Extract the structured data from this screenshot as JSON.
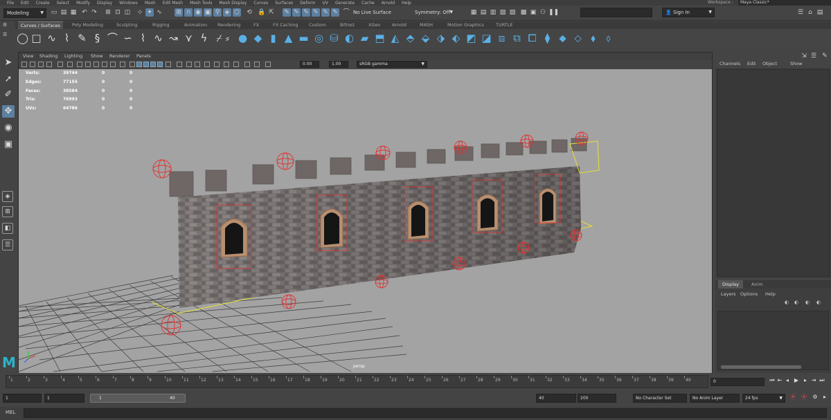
{
  "menubar": {
    "items": [
      "File",
      "Edit",
      "Create",
      "Select",
      "Modify",
      "Display",
      "Windows",
      "Mesh",
      "Edit Mesh",
      "Mesh Tools",
      "Mesh Display",
      "Curves",
      "Surfaces",
      "Deform",
      "UV",
      "Generate",
      "Cache",
      "Arnold",
      "Help"
    ],
    "workspace_label": "Workspace :",
    "workspace_value": "Maya Classic*"
  },
  "statusline": {
    "menuset": "Modeling",
    "live_surface": "No Live Surface",
    "symmetry": "Symmetry: Off",
    "sign_in": "Sign In"
  },
  "shelf": {
    "tabs": [
      "Curves / Surfaces",
      "Poly Modeling",
      "Sculpting",
      "Rigging",
      "Animation",
      "Rendering",
      "FX",
      "FX Caching",
      "Custom",
      "Bifrost",
      "XGen",
      "Arnold",
      "MASH",
      "Motion Graphics",
      "TURTLE"
    ],
    "active_tab": "Curves / Surfaces"
  },
  "panel": {
    "menus": [
      "View",
      "Shading",
      "Lighting",
      "Show",
      "Renderer",
      "Panels"
    ],
    "exposure": "0.00",
    "gamma": "1.00",
    "color_space": "sRGB gamma",
    "camera": "persp"
  },
  "hud": {
    "rows": [
      {
        "label": "Verts:",
        "total": "39744",
        "selected": "0",
        "components": "0"
      },
      {
        "label": "Edges:",
        "total": "77155",
        "selected": "0",
        "components": "0"
      },
      {
        "label": "Faces:",
        "total": "38584",
        "selected": "0",
        "components": "0"
      },
      {
        "label": "Tris:",
        "total": "76993",
        "selected": "0",
        "components": "0"
      },
      {
        "label": "UVs:",
        "total": "64786",
        "selected": "0",
        "components": "0"
      }
    ]
  },
  "channelbox": {
    "menus": [
      "Channels",
      "Edit",
      "Object",
      "Show"
    ]
  },
  "layerbox": {
    "tabs": [
      "Display",
      "Anim"
    ],
    "active_tab": "Display",
    "menus": [
      "Layers",
      "Options",
      "Help"
    ]
  },
  "timeslider": {
    "ticks": [
      "1",
      "2",
      "3",
      "4",
      "5",
      "6",
      "7",
      "8",
      "9",
      "10",
      "11",
      "12",
      "13",
      "14",
      "15",
      "16",
      "17",
      "18",
      "19",
      "20",
      "21",
      "22",
      "23",
      "24",
      "25",
      "26",
      "27",
      "28",
      "29",
      "30",
      "31",
      "32",
      "33",
      "34",
      "35",
      "36",
      "37",
      "38",
      "39",
      "40"
    ],
    "current_frame": "0"
  },
  "range": {
    "start": "1",
    "playback_start": "1",
    "slider_start": "1",
    "slider_end": "40",
    "playback_end": "40",
    "end": "200",
    "character_set": "No Character Set",
    "anim_layer": "No Anim Layer",
    "fps": "24 fps"
  },
  "cmdline": {
    "label": "MEL"
  },
  "colors": {
    "accent": "#5d7fa0",
    "viewport_bg": "#a3a3a3",
    "locator": "#e23030",
    "curve": "#e8e030"
  }
}
